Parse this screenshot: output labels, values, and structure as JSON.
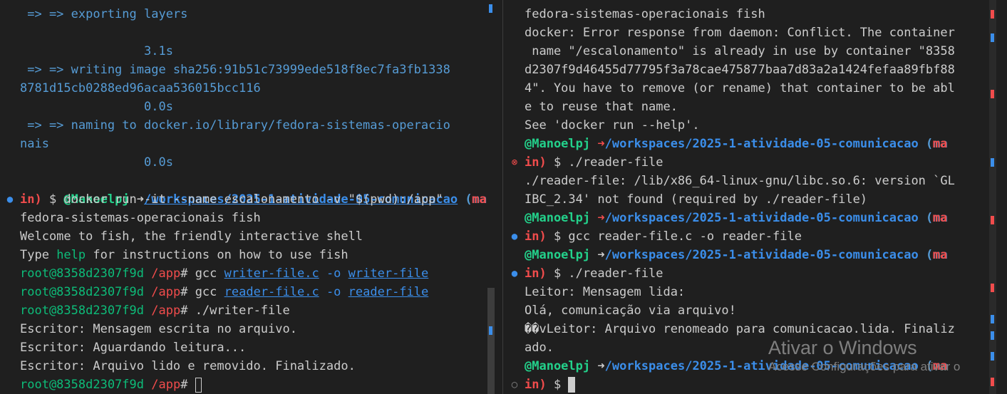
{
  "left": {
    "lines": [
      " => => exporting layers",
      "",
      "                 3.1s",
      " => => writing image sha256:91b51c73999ede518f8ec7fa3fb1338",
      "8781d15cb0288ed96acaa536015bcc116",
      "                 0.0s",
      " => => naming to docker.io/library/fedora-sistemas-operacio",
      "nais",
      "                 0.0s"
    ],
    "prompt_user": "@Manoelpj",
    "prompt_arrow": "➜",
    "prompt_path": "/workspaces/2025-1-atividade-05-comunicacao",
    "prompt_branch_open": " (ma",
    "prompt_branch_close": "in)",
    "docker_cmd": " $ docker run -it --name escalonamento -v \"$(pwd):/app\"",
    "docker_cmd_cont": "fedora-sistemas-operacionais fish",
    "welcome": "Welcome to fish, the friendly interactive shell",
    "type_prefix": "Type ",
    "type_help": "help",
    "type_suffix": " for instructions on how to use fish",
    "root": "root@8358d2307f9d",
    "app": "/app",
    "hash": "#",
    "gcc1_a": " gcc ",
    "gcc1_file": "writer-file.c",
    "gcc1_o": " -o ",
    "gcc1_out": "writer-file",
    "gcc2_a": " gcc ",
    "gcc2_file": "reader-file.c",
    "gcc2_o": " -o ",
    "gcc2_out": "reader-file",
    "run_writer": " ./writer-file",
    "out1": "Escritor: Mensagem escrita no arquivo.",
    "out2": "Escritor: Aguardando leitura...",
    "out3": "Escritor: Arquivo lido e removido. Finalizado."
  },
  "right": {
    "l1": "fedora-sistemas-operacionais fish",
    "l2": "docker: Error response from daemon: Conflict. The container",
    "l3": " name \"/escalonamento\" is already in use by container \"8358",
    "l4": "d2307f9d46455d77795f3a78cae475877baa7d83a2a1424fefaa89fbf88",
    "l5": "4\". You have to remove (or rename) that container to be abl",
    "l6": "e to reuse that name.",
    "l7": "See 'docker run --help'.",
    "prompt_user": "@Manoelpj",
    "prompt_arrow": "➜",
    "prompt_path": "/workspaces/2025-1-atividade-05-comunicacao",
    "prompt_branch_open": " (ma",
    "prompt_branch_close": "in)",
    "cmd_reader": " $ ./reader-file",
    "err1": "./reader-file: /lib/x86_64-linux-gnu/libc.so.6: version `GL",
    "err2": "IBC_2.34' not found (required by ./reader-file)",
    "cmd_gcc": " $ gcc reader-file.c -o reader-file",
    "out1": "Leitor: Mensagem lida:",
    "out2": "Olá, comunicação via arquivo!",
    "out3": "��vLeitor: Arquivo renomeado para comunicacao.lida. Finaliz",
    "out4": "ado.",
    "last_prompt": " $ "
  },
  "watermark": {
    "title": "Ativar o Windows",
    "subtitle": "Acesse Configurações para ativar o"
  },
  "colors": {
    "bg": "#1f1f1f",
    "fg": "#cccccc",
    "blue": "#569cd6",
    "path_blue": "#3b8eea",
    "green": "#23d18b",
    "red": "#f14c4c"
  }
}
